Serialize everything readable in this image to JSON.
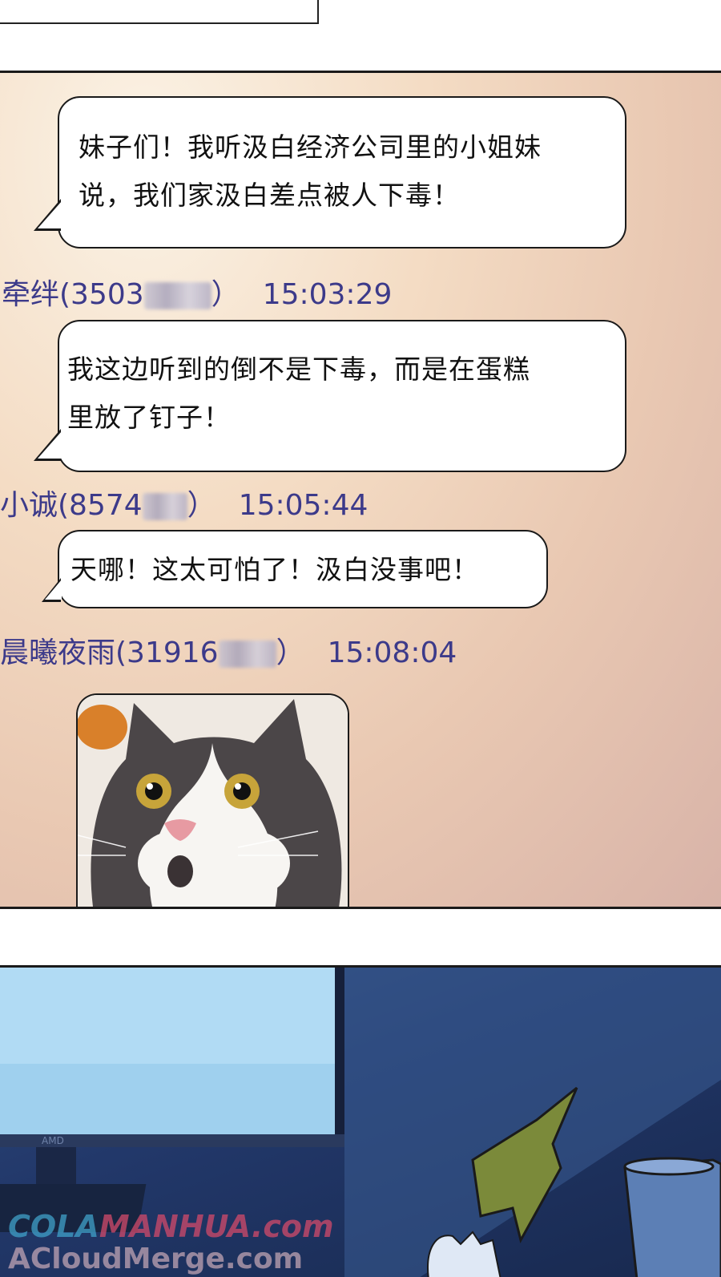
{
  "messages": [
    {
      "text_line1": "妹子们！我听汲白经济公司里的小姐妹",
      "text_line2": "说，我们家汲白差点被人下毒！"
    },
    {
      "sender": "牵绊(3503",
      "sender_close": "）",
      "time": "15:03:29",
      "text_line1": "我这边听到的倒不是下毒，而是在蛋糕",
      "text_line2": "里放了钉子！"
    },
    {
      "sender": "小诚(8574",
      "sender_close": "）",
      "time": "15:05:44",
      "text_line1": "天哪！这太可怕了！汲白没事吧！"
    },
    {
      "sender": "晨曦夜雨(31916",
      "sender_close": "）",
      "time": "15:08:04"
    }
  ],
  "sticker": {
    "icon": "surprised-cat-icon"
  },
  "monitor": {
    "brand": "AMD"
  },
  "watermarks": {
    "line1_prefix": "COLA",
    "line1_main": "MANHUA.com",
    "line2": "ACloudMerge.com"
  },
  "colors": {
    "name_text": "#3c3a8a",
    "bubble_border": "#1a1a1a",
    "chat_bg": "#f4dcc4",
    "room_bg": "#22386a"
  }
}
